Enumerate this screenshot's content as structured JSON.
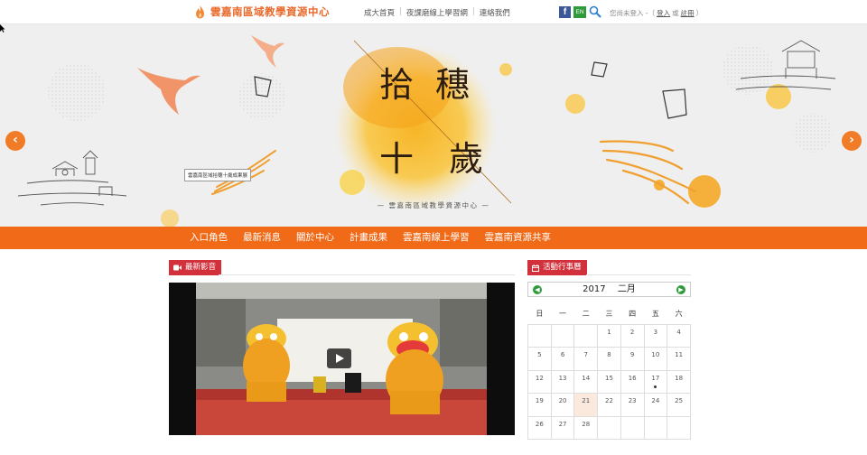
{
  "header": {
    "site_title": "雲嘉南區域教學資源中心",
    "nav": [
      "成大首頁",
      "夜課磨線上學習網",
      "連絡我們"
    ],
    "nav_sep": "|",
    "fb_label": "f",
    "en_label": "EN",
    "login_prefix": "您尚未登入 -（",
    "login_link": "登入",
    "login_or": "或",
    "register_link": "註冊",
    "login_suffix": "）"
  },
  "banner": {
    "title_chars": [
      "拾",
      "穗",
      "十",
      "歲"
    ],
    "subtitle": "— 雲嘉南區域教學資源中心 —",
    "tooltip": "雲嘉南區域拾穗十歲成果展",
    "prev": "‹",
    "next": "›",
    "colors": {
      "accent": "#f5b300",
      "ink": "#3a2a1a"
    }
  },
  "main_nav": [
    "入口角色",
    "最新消息",
    "關於中心",
    "計畫成果",
    "雲嘉南線上學習",
    "雲嘉南資源共享"
  ],
  "video_section": {
    "title": "最新影音",
    "icon": "video-camera-icon"
  },
  "calendar_section": {
    "title": "活動行事曆",
    "icon": "calendar-icon",
    "year": "2017",
    "month": "二月",
    "weekdays": [
      "日",
      "一",
      "二",
      "三",
      "四",
      "五",
      "六"
    ],
    "weeks": [
      [
        "",
        "",
        "",
        "1",
        "2",
        "3",
        "4"
      ],
      [
        "5",
        "6",
        "7",
        "8",
        "9",
        "10",
        "11"
      ],
      [
        "12",
        "13",
        "14",
        "15",
        "16",
        "17",
        "18"
      ],
      [
        "19",
        "20",
        "21",
        "22",
        "23",
        "24",
        "25"
      ],
      [
        "26",
        "27",
        "28",
        "",
        "",
        "",
        ""
      ]
    ],
    "today": "21",
    "event_days": [
      "17"
    ]
  },
  "colors": {
    "brand_orange": "#f06a18",
    "tag_red": "#d2303a",
    "cal_green": "#2e9b3b"
  }
}
